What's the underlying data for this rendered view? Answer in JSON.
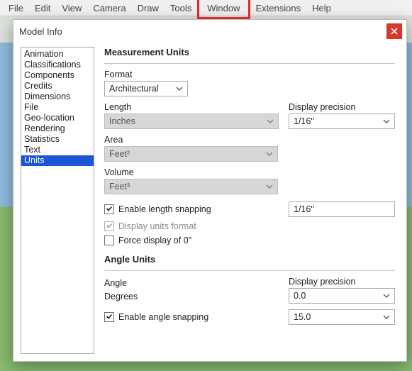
{
  "menu": {
    "items": [
      "File",
      "Edit",
      "View",
      "Camera",
      "Draw",
      "Tools",
      "Window",
      "Extensions",
      "Help"
    ],
    "highlighted_index": 6
  },
  "dialog": {
    "title": "Model Info",
    "sidebar": {
      "items": [
        "Animation",
        "Classifications",
        "Components",
        "Credits",
        "Dimensions",
        "File",
        "Geo-location",
        "Rendering",
        "Statistics",
        "Text",
        "Units"
      ],
      "selected_index": 10
    },
    "measurement": {
      "heading": "Measurement Units",
      "format_label": "Format",
      "format_value": "Architectural",
      "length_label": "Length",
      "length_value": "Inches",
      "display_precision_label": "Display precision",
      "display_precision_value": "1/16\"",
      "area_label": "Area",
      "area_value": "Feet²",
      "volume_label": "Volume",
      "volume_value": "Feet³",
      "enable_length_snapping_label": "Enable length snapping",
      "enable_length_snapping_value": "1/16\"",
      "display_units_format_label": "Display units format",
      "force_display_label": "Force display of 0\""
    },
    "angle": {
      "heading": "Angle Units",
      "angle_label": "Angle",
      "angle_value": "Degrees",
      "display_precision_label": "Display precision",
      "display_precision_value": "0.0",
      "enable_angle_snapping_label": "Enable angle snapping",
      "enable_angle_snapping_value": "15.0"
    }
  }
}
